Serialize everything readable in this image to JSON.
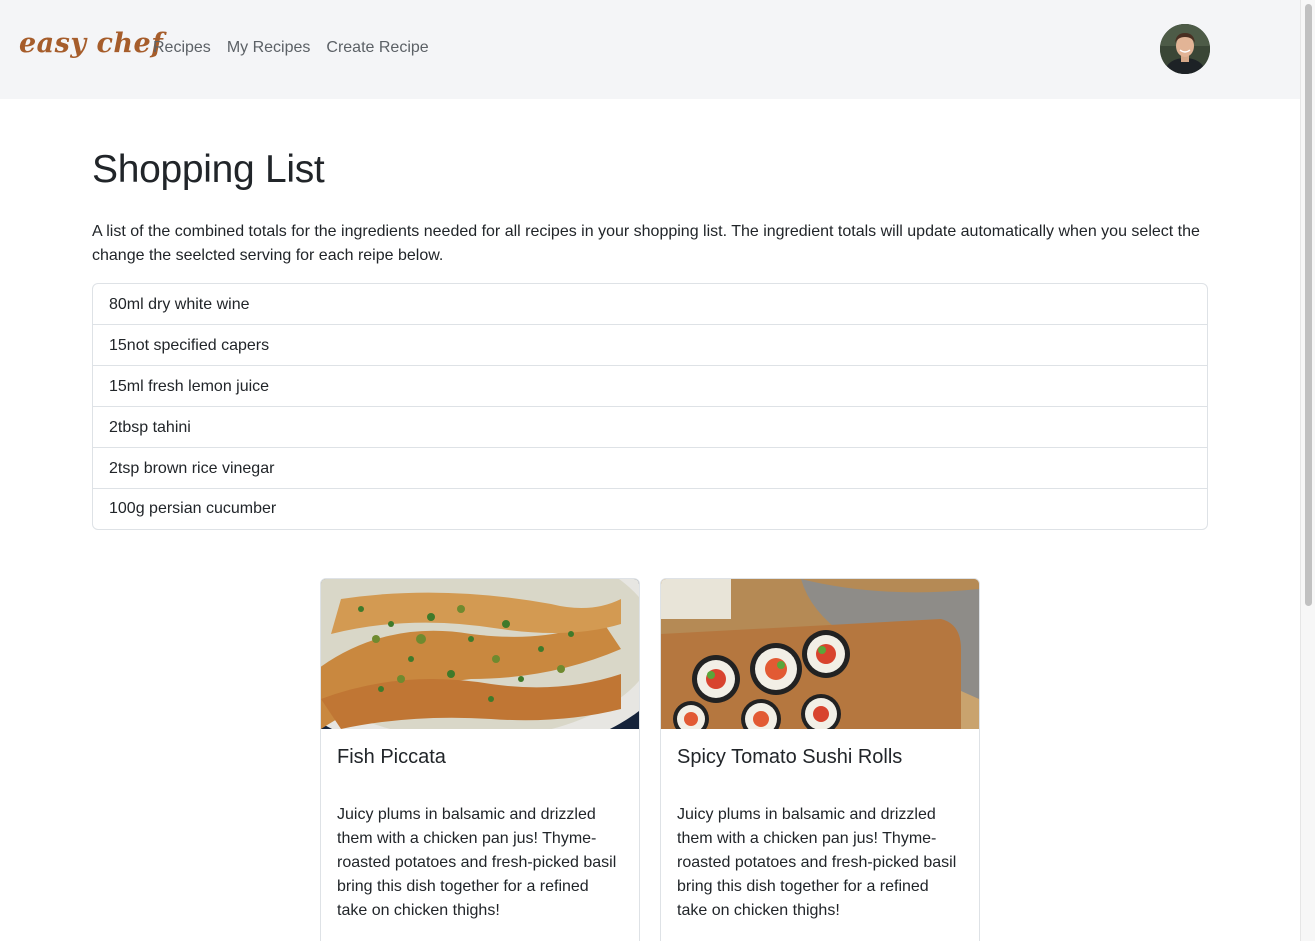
{
  "navbar": {
    "brand": "easy chef",
    "links": [
      "Recipes",
      "My Recipes",
      "Create Recipe"
    ]
  },
  "main": {
    "title": "Shopping List",
    "description": "A list of the combined totals for the ingredients needed for all recipes in your shopping list. The ingredient totals will update automatically when you select the change the seelcted serving for each reipe below.",
    "ingredients": [
      "80ml dry white wine",
      "15not specified capers",
      "15ml fresh lemon juice",
      "2tbsp tahini",
      "2tsp brown rice vinegar",
      "100g persian cucumber"
    ]
  },
  "recipes": [
    {
      "title": "Fish Piccata",
      "description": "Juicy plums in balsamic and drizzled them with a chicken pan jus! Thyme-roasted potatoes and fresh-picked basil bring this dish together for a refined take on chicken thighs!"
    },
    {
      "title": "Spicy Tomato Sushi Rolls",
      "description": "Juicy plums in balsamic and drizzled them with a chicken pan jus! Thyme-roasted potatoes and fresh-picked basil bring this dish together for a refined take on chicken thighs!"
    }
  ],
  "colors": {
    "brand": "#a65d2b",
    "navbar_bg": "#f4f5f7",
    "border": "#dee2e6",
    "nav_link": "#5c6166"
  }
}
